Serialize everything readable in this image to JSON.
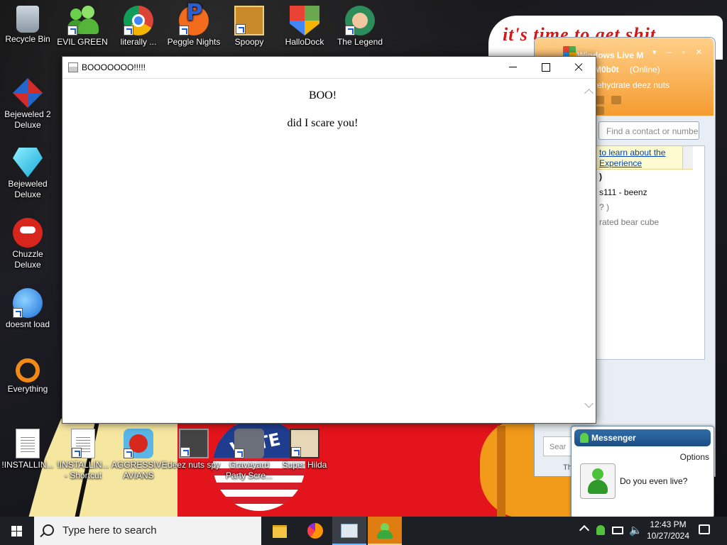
{
  "wallpaper": {
    "banner_text": "it's time to get shit",
    "vote_text": "VOTE"
  },
  "desktop_icons": [
    {
      "label": "Recycle Bin",
      "icon": "recycle-bin-icon"
    },
    {
      "label": "EVIL GREEN MEN CO...",
      "icon": "messenger-icon"
    },
    {
      "label": "literally ...",
      "icon": "chrome-icon"
    },
    {
      "label": "Peggle Nights De...",
      "icon": "peggle-icon"
    },
    {
      "label": "Spoopy",
      "icon": "spoopy-icon"
    },
    {
      "label": "HalloDock",
      "icon": "shield-icon"
    },
    {
      "label": "The Legend of Zel...",
      "icon": "zelda-icon"
    },
    {
      "label": "Bejeweled 2 Deluxe",
      "icon": "bejeweled-2-icon"
    },
    {
      "label": "Bejeweled Deluxe",
      "icon": "bejeweled-icon"
    },
    {
      "label": "Chuzzle Deluxe",
      "icon": "chuzzle-icon"
    },
    {
      "label": "doesnt load",
      "icon": "thunderbird-icon"
    },
    {
      "label": "Everything",
      "icon": "everything-icon"
    },
    {
      "label": "!INSTALLIN...",
      "icon": "document-icon"
    },
    {
      "label": "!INSTALLIN... - Shortcut",
      "icon": "document-icon"
    },
    {
      "label": "AGGRESSIVE AVIANS",
      "icon": "angry-birds-icon"
    },
    {
      "label": "deez nuts spy",
      "icon": "spy-icon"
    },
    {
      "label": "Graveyard Party Scre...",
      "icon": "graveyard-icon"
    },
    {
      "label": "Super Hilda",
      "icon": "hilda-icon"
    }
  ],
  "boo_window": {
    "title": "BOOOOOOO!!!!!",
    "heading": "BOO!",
    "paragraph": "did I scare you!"
  },
  "messenger_window": {
    "title": "Windows Live M",
    "display_name": "M0b0t",
    "status": "(Online)",
    "personal_message": "rehydrate deez nuts",
    "search_placeholder": "Find a contact or numbe",
    "banner_line1": "to learn about the",
    "banner_line2": "Experience",
    "contacts": [
      {
        "text": ")",
        "style": "bold"
      },
      {
        "text": "s111 - beenz",
        "style": "normal"
      },
      {
        "text": "? )",
        "style": "grey"
      },
      {
        "text": "rated bear cube",
        "style": "grey"
      }
    ],
    "footer_search": "Sear",
    "footer_text": "Th"
  },
  "messenger_toast": {
    "title": "Messenger",
    "options_label": "Options",
    "message": "Do you even live?"
  },
  "taskbar": {
    "search_placeholder": "Type here to search",
    "apps": [
      "file-explorer-icon",
      "firefox-icon",
      "window-app-icon",
      "messenger-icon"
    ],
    "time": "12:43 PM",
    "date": "10/27/2024"
  }
}
